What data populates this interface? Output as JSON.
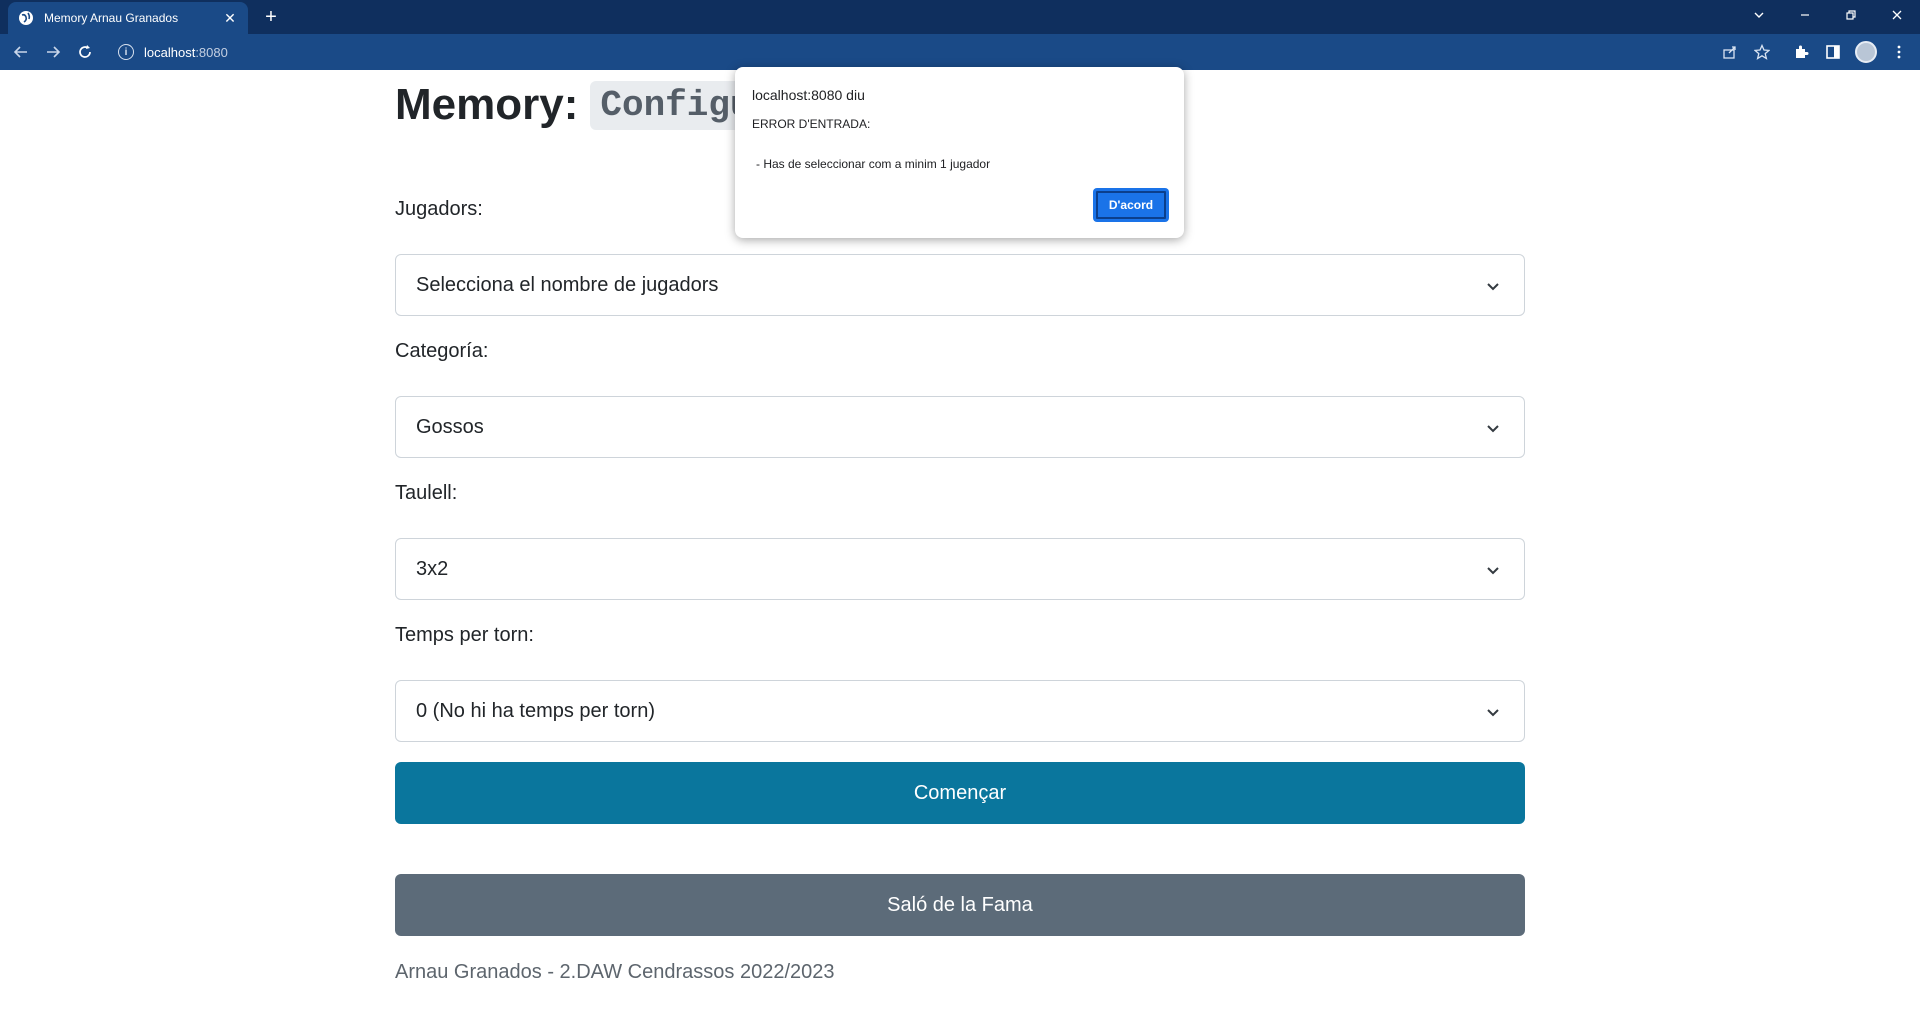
{
  "browser": {
    "tab_title": "Memory Arnau Granados",
    "tab_close": "✕",
    "new_tab": "+",
    "url_host": "localhost",
    "url_port": ":8080"
  },
  "page": {
    "title": "Memory:",
    "subtitle_code": "Configur",
    "fields": {
      "players": {
        "label": "Jugadors:",
        "value": "Selecciona el nombre de jugadors"
      },
      "category": {
        "label": "Categoría:",
        "value": "Gossos"
      },
      "board": {
        "label": "Taulell:",
        "value": "3x2"
      },
      "time": {
        "label": "Temps per torn:",
        "value": "0 (No hi ha temps per torn)"
      }
    },
    "start_button": "Començar",
    "fame_button": "Saló de la Fama",
    "footer": "Arnau Granados - 2.DAW Cendrassos 2022/2023"
  },
  "dialog": {
    "origin": "localhost:8080 diu",
    "line1": "ERROR D'ENTRADA:",
    "line2": " - Has de seleccionar com a minim 1 jugador",
    "ok_label": "D'acord"
  },
  "colors": {
    "chrome_dark": "#0f2f5e",
    "chrome_toolbar": "#1a4a87",
    "primary_button": "#0a769d",
    "secondary_button": "#5c6b79",
    "dialog_button": "#1a73e8"
  }
}
